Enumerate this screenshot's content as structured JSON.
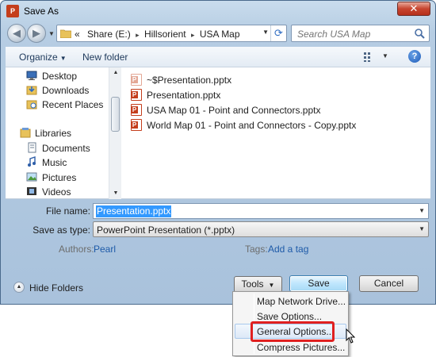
{
  "window": {
    "title": "Save As",
    "app_icon_letter": "P",
    "close_glyph": "✕"
  },
  "nav": {
    "back_glyph": "◀",
    "forward_glyph": "▶",
    "breadcrumb_prefix": "«",
    "breadcrumb": [
      "Share (E:)",
      "Hillsorient",
      "USA Map"
    ],
    "breadcrumb_separator": "▸",
    "search_placeholder": "Search USA Map"
  },
  "toolbar": {
    "organize_label": "Organize",
    "new_folder_label": "New folder",
    "help_glyph": "?"
  },
  "sidebar": {
    "items": [
      {
        "label": "Desktop",
        "icon": "desktop-icon"
      },
      {
        "label": "Downloads",
        "icon": "downloads-icon"
      },
      {
        "label": "Recent Places",
        "icon": "recent-places-icon"
      },
      {
        "label": "Libraries",
        "icon": "libraries-icon"
      },
      {
        "label": "Documents",
        "icon": "documents-icon"
      },
      {
        "label": "Music",
        "icon": "music-icon"
      },
      {
        "label": "Pictures",
        "icon": "pictures-icon"
      },
      {
        "label": "Videos",
        "icon": "videos-icon"
      }
    ]
  },
  "files": [
    {
      "name": "~$Presentation.pptx",
      "icon": "powerpoint-temp-file-icon"
    },
    {
      "name": "Presentation.pptx",
      "icon": "powerpoint-file-icon"
    },
    {
      "name": "USA Map 01 - Point and Connectors.pptx",
      "icon": "powerpoint-file-icon"
    },
    {
      "name": "World Map 01 - Point and Connectors - Copy.pptx",
      "icon": "powerpoint-file-icon"
    }
  ],
  "form": {
    "filename_label": "File name:",
    "filename_value": "Presentation.pptx",
    "savetype_label": "Save as type:",
    "savetype_value": "PowerPoint Presentation (*.pptx)",
    "authors_label": "Authors:",
    "authors_value": "Pearl",
    "tags_label": "Tags:",
    "tags_value": "Add a tag"
  },
  "footer": {
    "hide_folders_label": "Hide Folders",
    "tools_label": "Tools",
    "save_label": "Save",
    "cancel_label": "Cancel"
  },
  "tools_menu": {
    "items": [
      {
        "label": "Map Network Drive..."
      },
      {
        "label": "Save Options..."
      },
      {
        "label": "General Options..."
      },
      {
        "label": "Compress Pictures..."
      }
    ]
  },
  "colors": {
    "highlight_box": "#e02020",
    "selection": "#3399ff",
    "link": "#1e5aa8",
    "powerpoint": "#c43e1c"
  }
}
